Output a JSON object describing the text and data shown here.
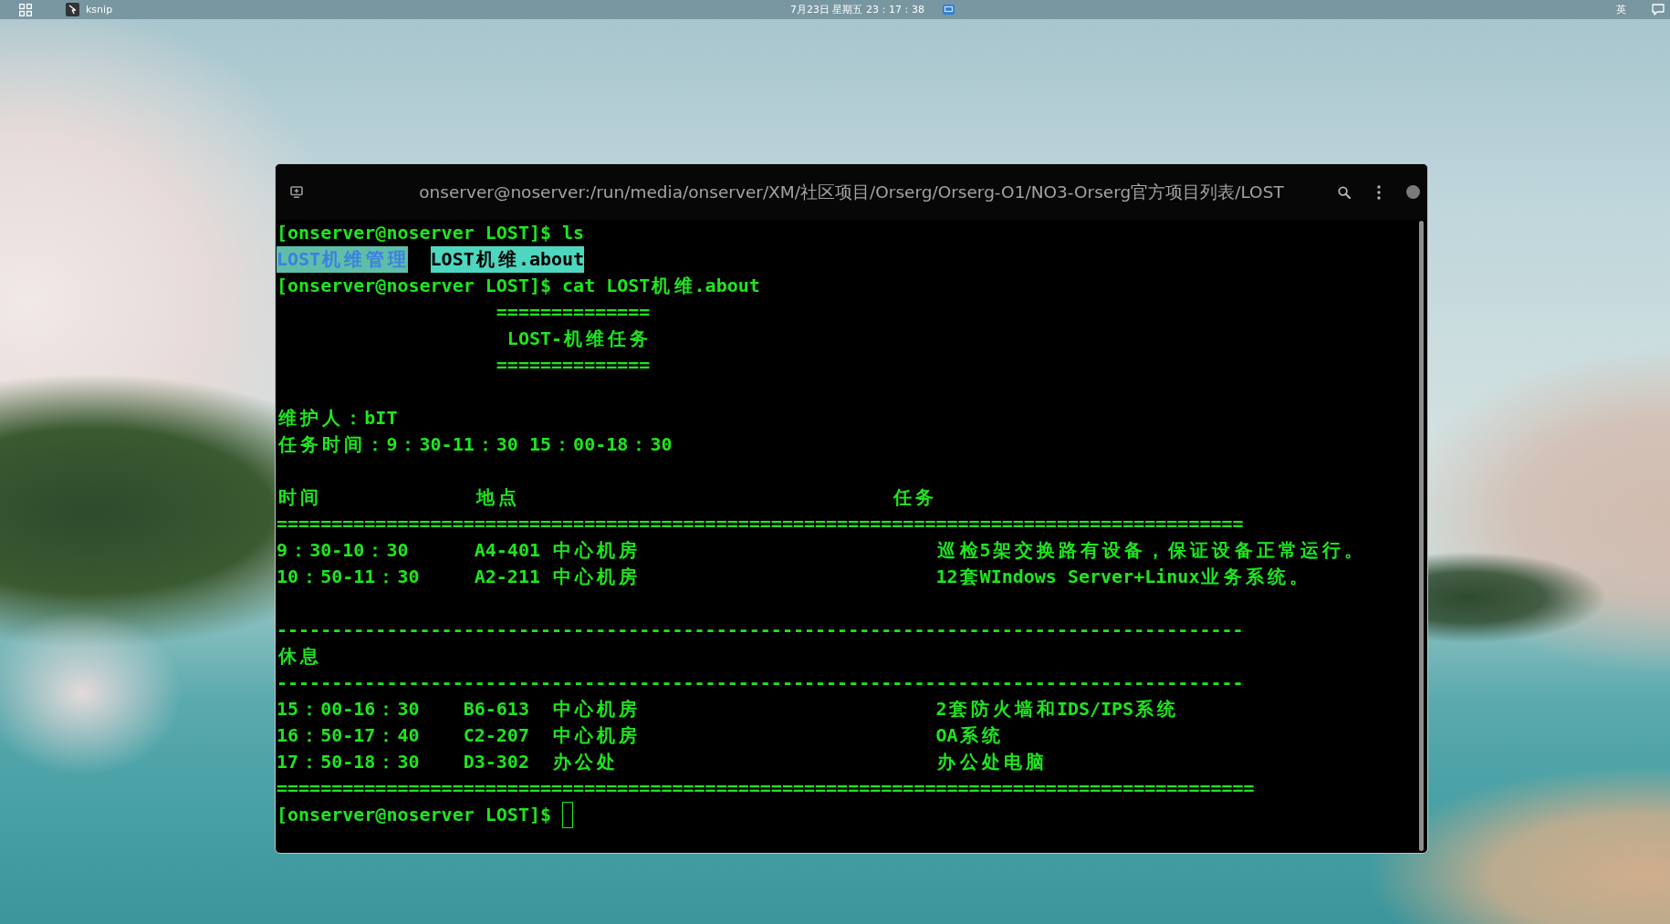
{
  "top_bar": {
    "app_name": "ksnip",
    "clock": "7月23日 星期五 23：17：38",
    "input_method": "英"
  },
  "terminal": {
    "title": "onserver@noserver:/run/media/onserver/XM/社区项目/Orserg/Orserg-O1/NO3-Orserg官方项目列表/LOST",
    "session": [
      {
        "kind": "command",
        "prompt": "[onserver@noserver LOST]$",
        "command": "ls"
      },
      {
        "kind": "listing",
        "entries": [
          {
            "name": "LOST机维管理",
            "kind": "directory"
          },
          {
            "name": "LOST机维.about",
            "kind": "file"
          }
        ]
      },
      {
        "kind": "command",
        "prompt": "[onserver@noserver LOST]$",
        "command": "cat LOST机维.about"
      },
      {
        "kind": "document",
        "banner": {
          "rule_top": "==============",
          "title": "LOST-机维任务",
          "rule_bottom": "=============="
        },
        "info": [
          "维护人：bIT",
          "任务时间：9：30-11：30 15：00-18：30"
        ],
        "table": {
          "columns": [
            "时间",
            "地点",
            "任务"
          ],
          "header_rule": "========================================================================================",
          "rows_before_break": [
            {
              "time": "9：30-10：30",
              "room": "A4-401",
              "site": "中心机房",
              "task": "巡检5架交换路有设备，保证设备正常运行。"
            },
            {
              "time": "10：50-11：30",
              "room": "A2-211",
              "site": "中心机房",
              "task": "12套WIndows Server+Linux业务系统。"
            }
          ],
          "break": {
            "rule_top": "----------------------------------------------------------------------------------------",
            "label": "休息",
            "rule_bottom": "----------------------------------------------------------------------------------------"
          },
          "rows_after_break": [
            {
              "time": "15：00-16：30",
              "room": "B6-613",
              "site": "中心机房",
              "task": "2套防火墙和IDS/IPS系统"
            },
            {
              "time": "16：50-17：40",
              "room": "C2-207",
              "site": "中心机房",
              "task": "OA系统"
            },
            {
              "time": "17：50-18：30",
              "room": "D3-302",
              "site": "办公处",
              "task": "办公处电脑"
            }
          ],
          "footer_rule": "========================================================================================="
        }
      },
      {
        "kind": "prompt",
        "prompt": "[onserver@noserver LOST]$"
      }
    ]
  }
}
